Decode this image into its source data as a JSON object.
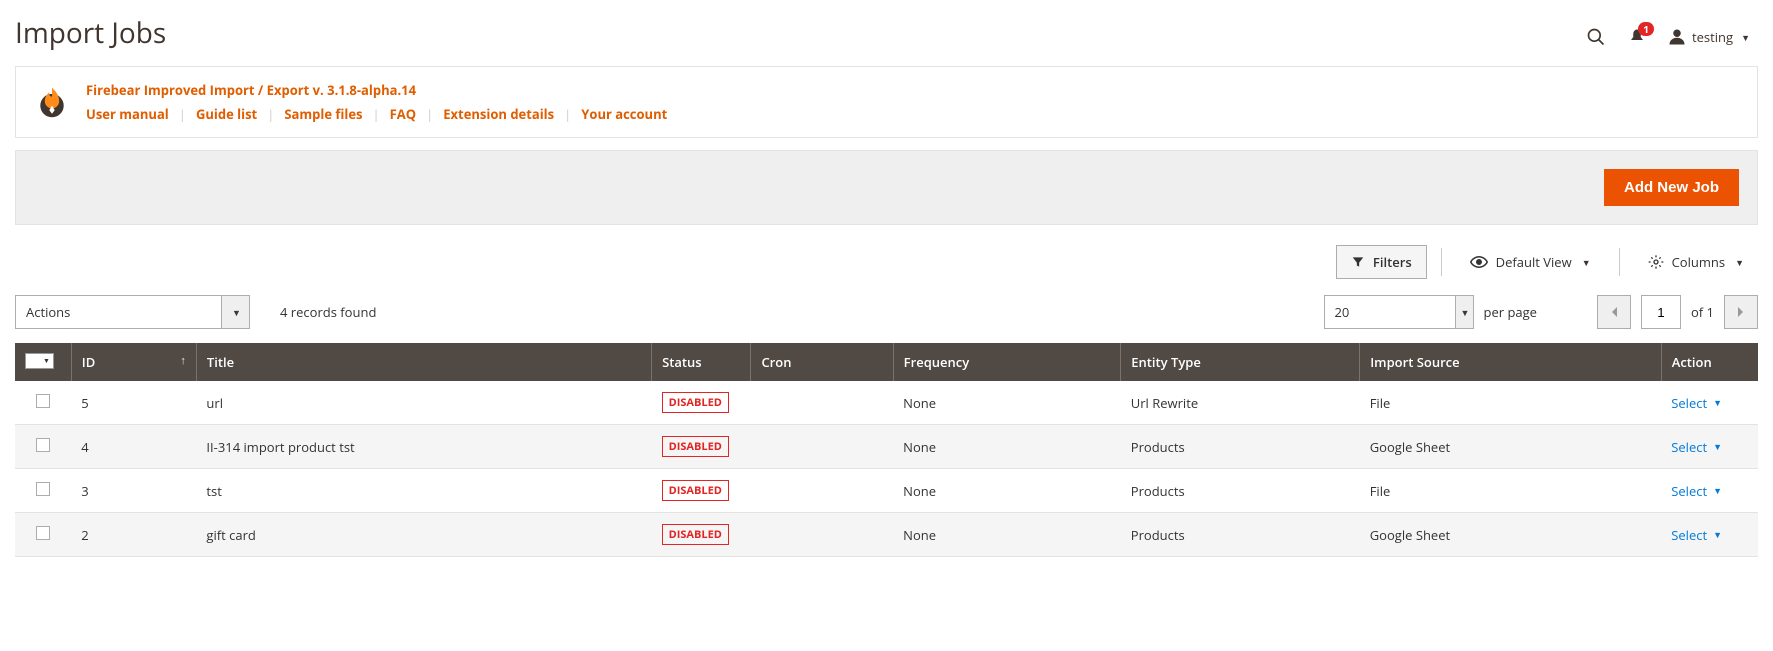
{
  "header": {
    "title": "Import Jobs",
    "notif_count": "1",
    "username": "testing"
  },
  "infobar": {
    "title": "Firebear Improved Import / Export v. 3.1.8-alpha.14",
    "links": [
      "User manual",
      "Guide list",
      "Sample files",
      "FAQ",
      "Extension details",
      "Your account"
    ]
  },
  "actions": {
    "add_button": "Add New Job"
  },
  "toolbar": {
    "filters": "Filters",
    "default_view": "Default View",
    "columns": "Columns"
  },
  "grid": {
    "actions_label": "Actions",
    "records_found": "4 records found",
    "per_page_value": "20",
    "per_page_label": "per page",
    "page_current": "1",
    "page_of": "of 1"
  },
  "columns": {
    "id": "ID",
    "title": "Title",
    "status": "Status",
    "cron": "Cron",
    "frequency": "Frequency",
    "entity_type": "Entity Type",
    "import_source": "Import Source",
    "action": "Action"
  },
  "rows": [
    {
      "id": "5",
      "title": "url",
      "status": "DISABLED",
      "cron": "",
      "frequency": "None",
      "entity": "Url Rewrite",
      "source": "File",
      "action": "Select"
    },
    {
      "id": "4",
      "title": "II-314 import product tst",
      "status": "DISABLED",
      "cron": "",
      "frequency": "None",
      "entity": "Products",
      "source": "Google Sheet",
      "action": "Select"
    },
    {
      "id": "3",
      "title": "tst",
      "status": "DISABLED",
      "cron": "",
      "frequency": "None",
      "entity": "Products",
      "source": "File",
      "action": "Select"
    },
    {
      "id": "2",
      "title": "gift card",
      "status": "DISABLED",
      "cron": "",
      "frequency": "None",
      "entity": "Products",
      "source": "Google Sheet",
      "action": "Select"
    }
  ]
}
